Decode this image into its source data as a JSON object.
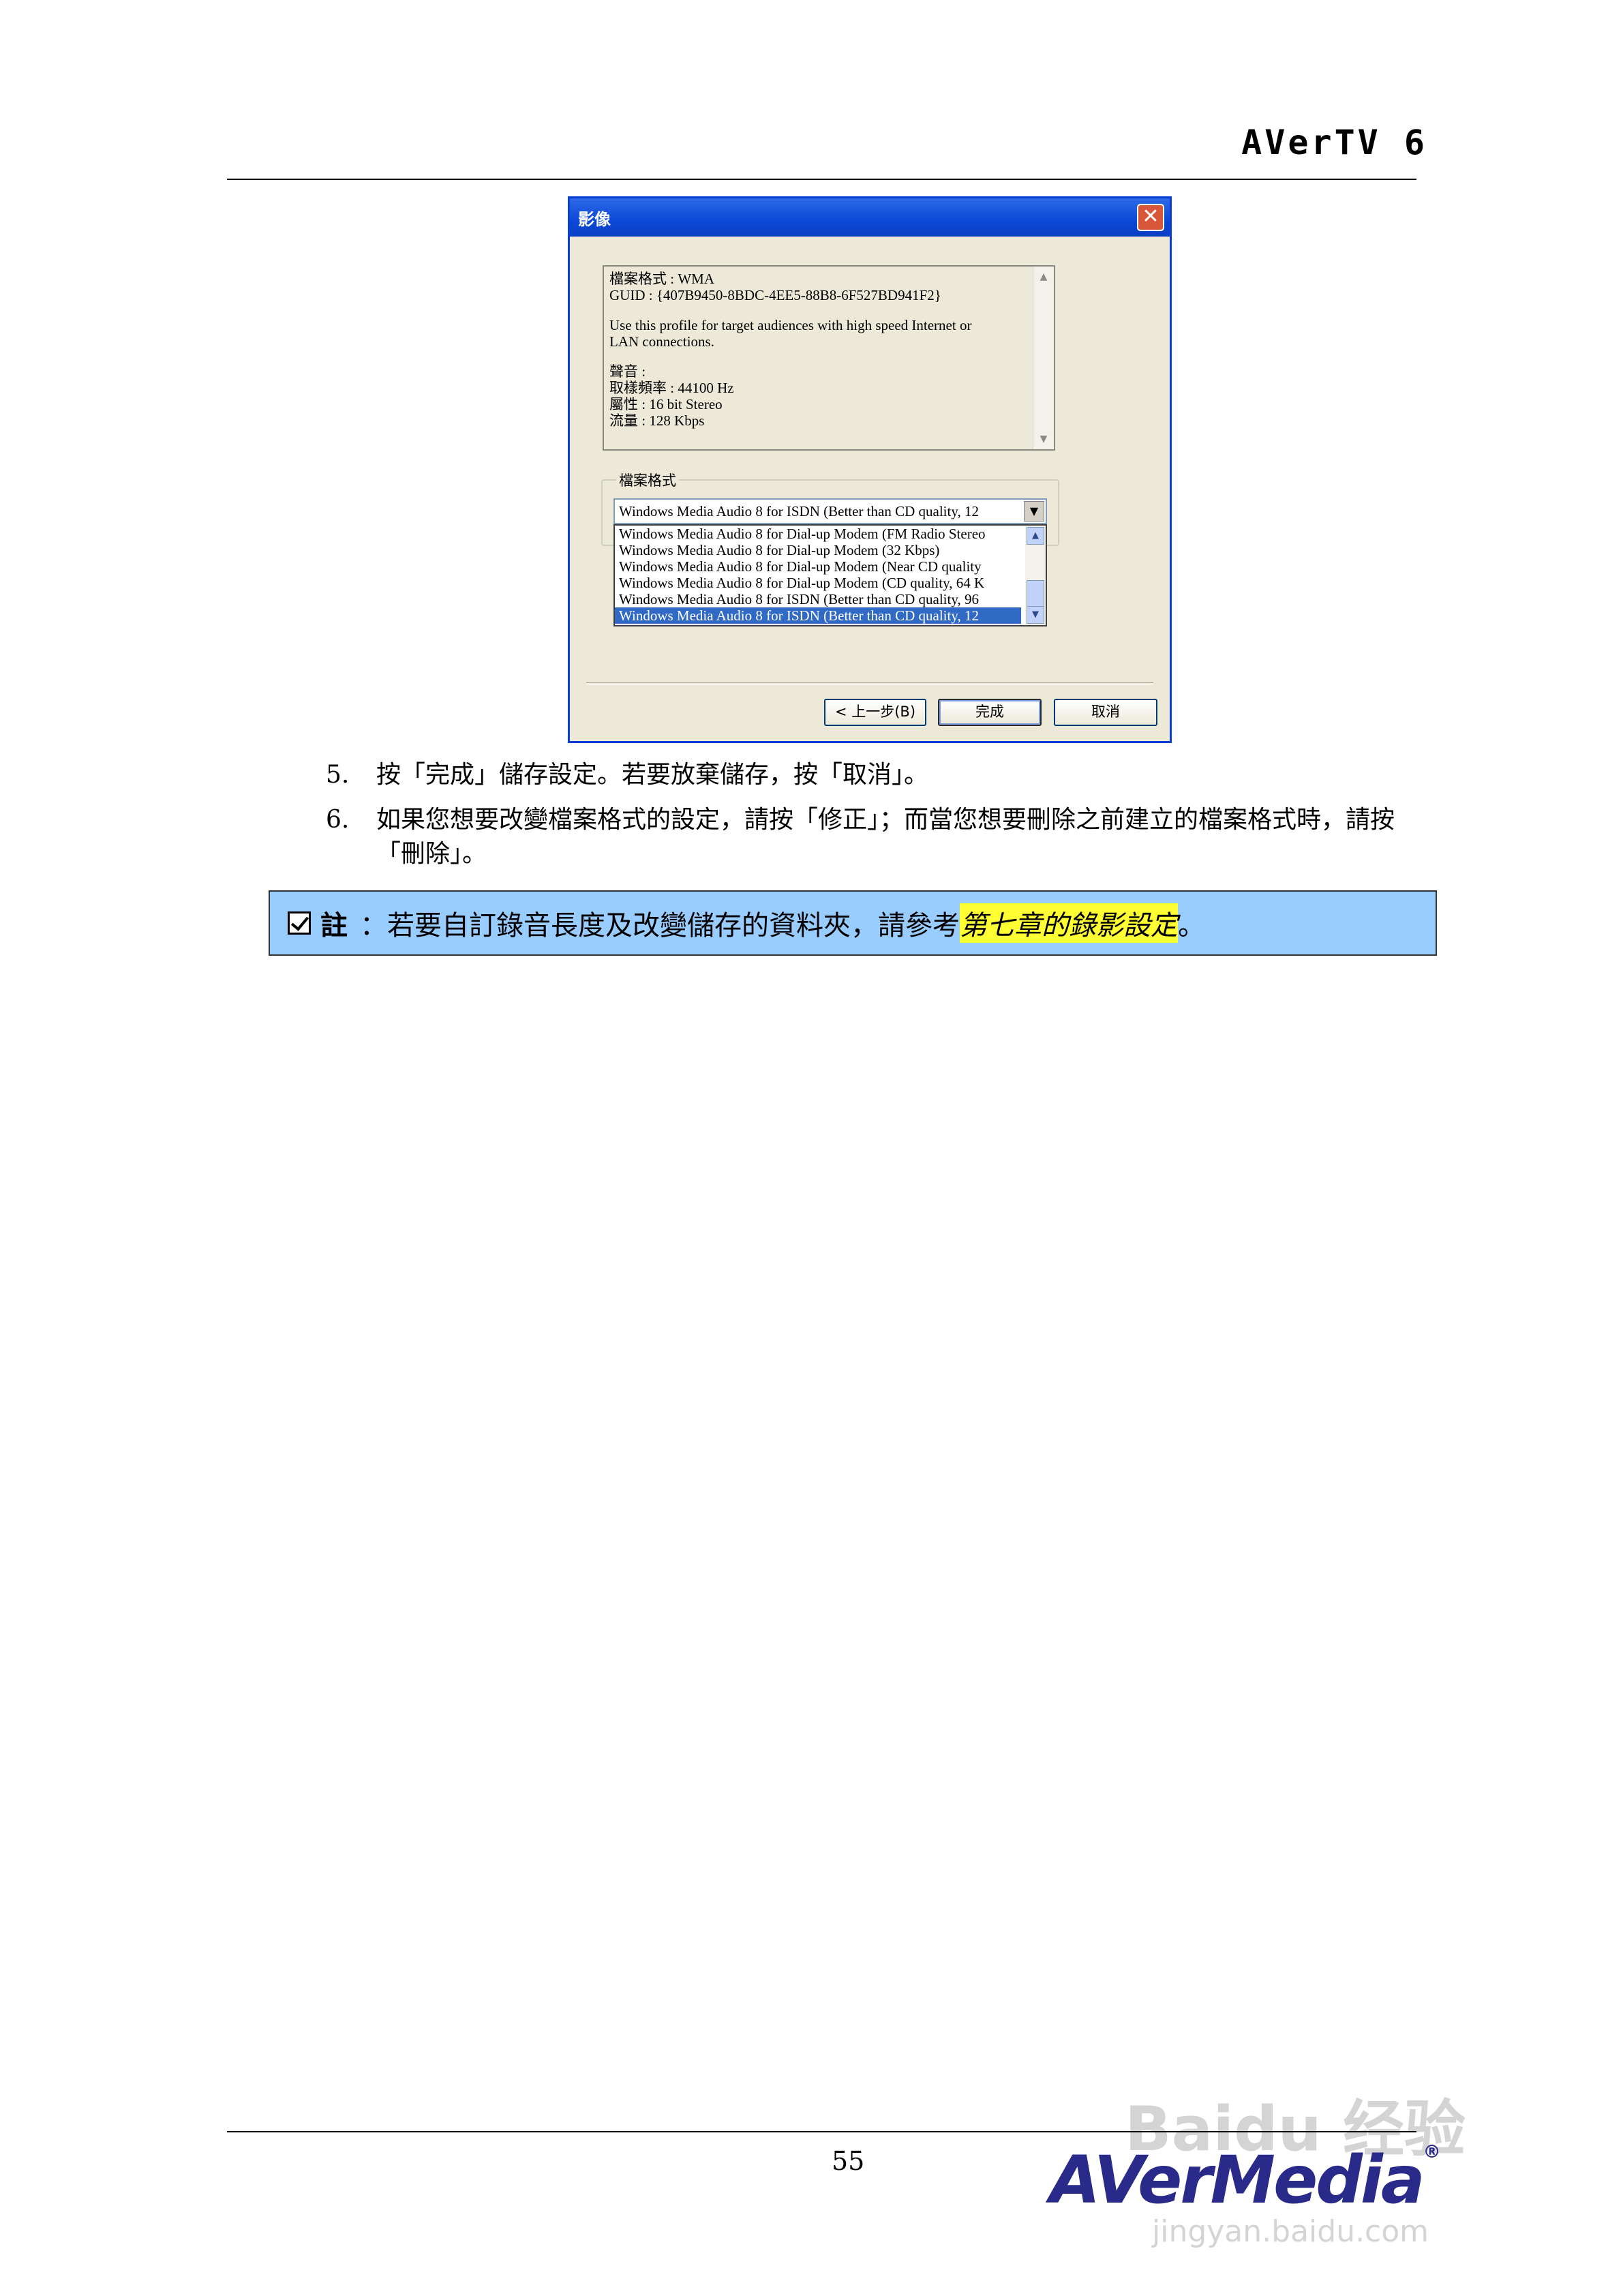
{
  "header": {
    "title": "AVerTV 6"
  },
  "dialog": {
    "title": "影像",
    "info_lines": [
      "檔案格式 : WMA",
      "GUID : {407B9450-8BDC-4EE5-88B8-6F527BD941F2}",
      "",
      "Use this profile for target audiences with high speed Internet or",
      "LAN connections.",
      "",
      "聲音 :",
      "取樣頻率 : 44100 Hz",
      "屬性 : 16 bit Stereo",
      "流量 : 128 Kbps"
    ],
    "group_label": "檔案格式",
    "combo_value": "Windows Media Audio 8 for ISDN (Better than CD quality, 12",
    "options": [
      "Windows Media Audio 8 for Dial-up Modem (FM Radio Stereo",
      "Windows Media Audio 8 for Dial-up Modem (32 Kbps)",
      "Windows Media Audio 8 for Dial-up Modem (Near CD quality",
      "Windows Media Audio 8 for Dial-up Modem (CD quality, 64 K",
      "Windows Media Audio 8 for ISDN (Better than CD quality, 96",
      "Windows Media Audio 8 for ISDN (Better than CD quality, 12"
    ],
    "buttons": {
      "back": "< 上一步(B)",
      "finish": "完成",
      "cancel": "取消"
    }
  },
  "steps": [
    {
      "num": "5.",
      "text": "按「完成」儲存設定。若要放棄儲存，按「取消」。"
    },
    {
      "num": "6.",
      "text": "如果您想要改變檔案格式的設定，請按「修正」；而當您想要刪除之前建立的檔案格式時，請按「刪除」。"
    }
  ],
  "note": {
    "label": "註",
    "text": "：若要自訂錄音長度及改變儲存的資料夾，請參考",
    "link": "第七章的錄影設定",
    "end": "。"
  },
  "footer": {
    "page_number": "55",
    "logo": "AVerMedia",
    "logo_mark": "®",
    "watermark": "Baidu 经验",
    "watermark_url": "jingyan.baidu.com"
  }
}
